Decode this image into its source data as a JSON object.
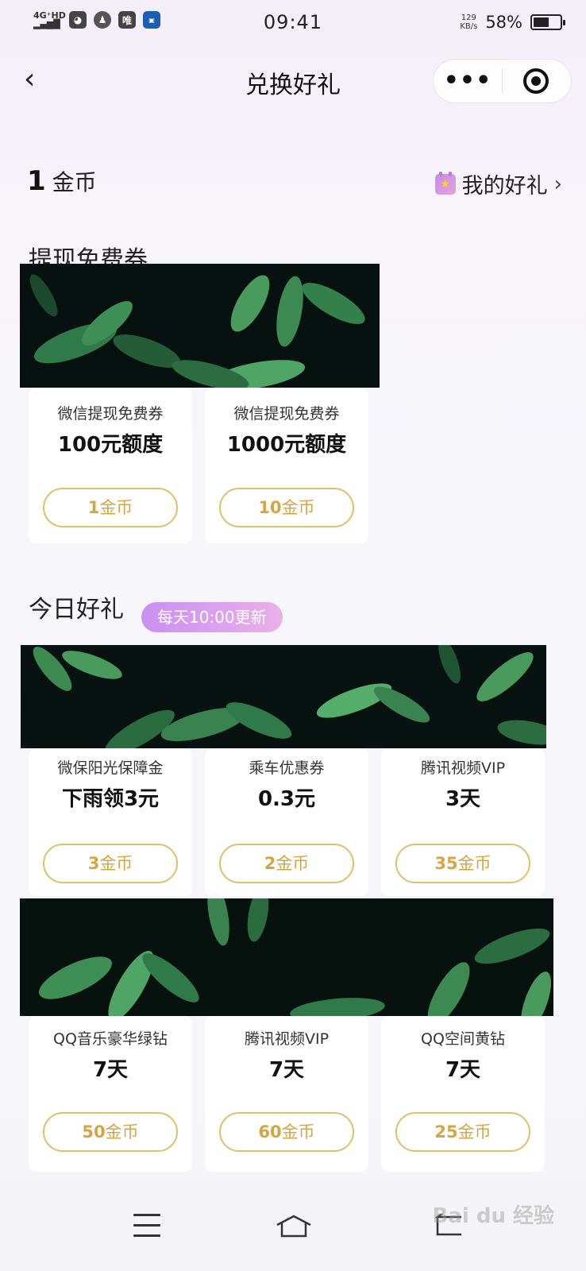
{
  "status_bar": {
    "network": "4G⁺HD",
    "time": "09:41",
    "speed_value": "129",
    "speed_unit": "KB/s",
    "battery_percent": "58%",
    "battery_level": 0.58,
    "icons": [
      "signal-icon",
      "wechat-icon",
      "qq-icon",
      "vip-icon",
      "app-icon"
    ],
    "vip_label": "唯"
  },
  "nav": {
    "title": "兑换好礼",
    "back_icon": "chevron-left-icon",
    "more_icon": "more-dots-icon",
    "close_icon": "target-icon"
  },
  "account": {
    "coins": "1",
    "coins_unit": "金币",
    "my_gifts_label": "我的好礼"
  },
  "sections": {
    "withdraw_title": "提现免费券",
    "today_title": "今日好礼",
    "today_badge": "每天10:00更新"
  },
  "withdraw_cards": [
    {
      "name": "微信提现免费券",
      "value": "100元额度",
      "price": "1",
      "unit": "金币"
    },
    {
      "name": "微信提现免费券",
      "value": "1000元额度",
      "price": "10",
      "unit": "金币"
    }
  ],
  "today_cards": [
    {
      "name": "微保阳光保障金",
      "value": "下雨领3元",
      "price": "3",
      "unit": "金币"
    },
    {
      "name": "乘车优惠券",
      "value": "0.3元",
      "price": "2",
      "unit": "金币"
    },
    {
      "name": "腾讯视频VIP",
      "value": "3天",
      "price": "35",
      "unit": "金币"
    },
    {
      "name": "QQ音乐豪华绿钻",
      "value": "7天",
      "price": "50",
      "unit": "金币"
    },
    {
      "name": "腾讯视频VIP",
      "value": "7天",
      "price": "60",
      "unit": "金币"
    },
    {
      "name": "QQ空间黄钻",
      "value": "7天",
      "price": "25",
      "unit": "金币"
    }
  ],
  "bottom_nav": {
    "icons": [
      "menu-icon",
      "home-icon",
      "back-icon"
    ]
  },
  "watermark": "Bai du 经验",
  "colors": {
    "accent_gold": "#e2be68",
    "badge_purple": "#c990f2"
  }
}
